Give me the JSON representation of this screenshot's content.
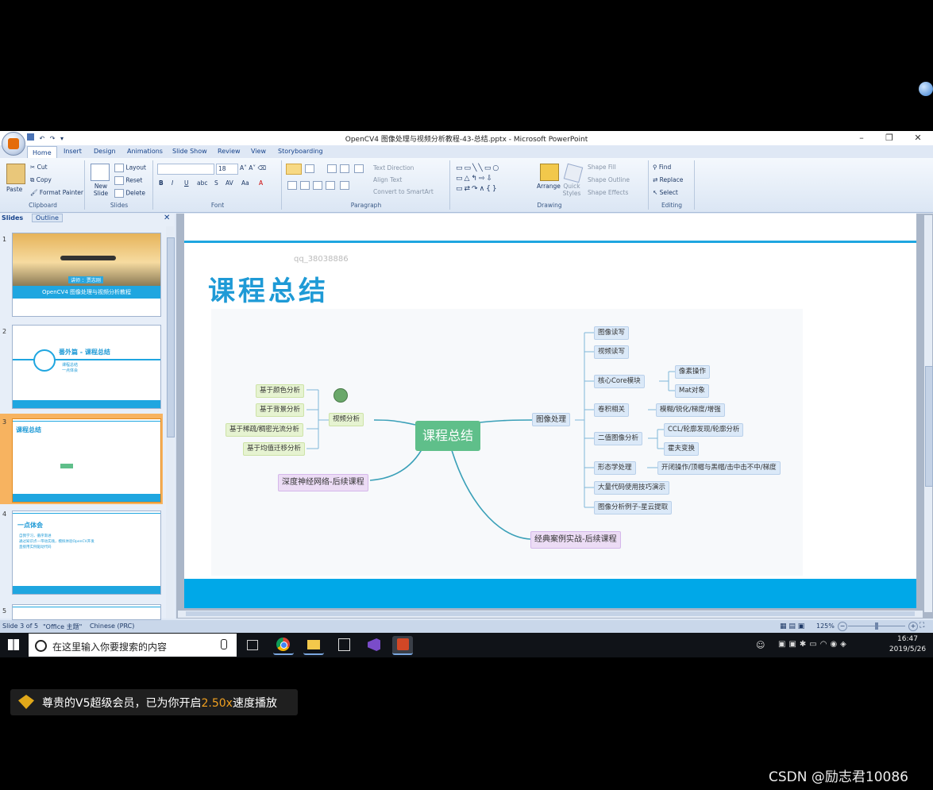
{
  "window": {
    "title": "OpenCV4 图像处理与视频分析教程-43-总结.pptx - Microsoft PowerPoint",
    "controls": {
      "minimize": "–",
      "restore": "❐",
      "close": "✕"
    }
  },
  "ribbon": {
    "tabs": [
      "Home",
      "Insert",
      "Design",
      "Animations",
      "Slide Show",
      "Review",
      "View",
      "Storyboarding"
    ],
    "active_tab": "Home",
    "clipboard": {
      "paste": "Paste",
      "cut": "Cut",
      "copy": "Copy",
      "format_painter": "Format Painter",
      "label": "Clipboard"
    },
    "slides": {
      "new_slide": "New Slide",
      "layout": "Layout",
      "reset": "Reset",
      "delete": "Delete",
      "label": "Slides"
    },
    "font": {
      "size": "18",
      "label": "Font"
    },
    "paragraph": {
      "text_direction": "Text Direction",
      "align_text": "Align Text",
      "convert_smartart": "Convert to SmartArt",
      "label": "Paragraph"
    },
    "drawing": {
      "arrange": "Arrange",
      "quick_styles": "Quick Styles",
      "shape_fill": "Shape Fill",
      "shape_outline": "Shape Outline",
      "shape_effects": "Shape Effects",
      "label": "Drawing"
    },
    "editing": {
      "find": "Find",
      "replace": "Replace",
      "select": "Select",
      "label": "Editing"
    }
  },
  "slides_pane": {
    "tabs": [
      "Slides",
      "Outline"
    ],
    "close": "✕",
    "thumbnails": [
      {
        "number": "1",
        "caption": "OpenCV4 图像处理与视频分析教程",
        "badge": "讲师 ：贾志刚"
      },
      {
        "number": "2",
        "title": "番外篇 - 课程总结",
        "bullets": [
          "课程总结",
          "一点体会"
        ]
      },
      {
        "number": "3",
        "title": "课程总结"
      },
      {
        "number": "4",
        "title": "一点体会",
        "bullets": [
          "自我学习，循序渐进",
          "通过知识点—带动实践，模拟体验OpenCV开发",
          "直接用实例驱动代码"
        ]
      },
      {
        "number": "5"
      }
    ]
  },
  "slide": {
    "watermark": "qq_38038886",
    "title": "课程总结",
    "mindmap": {
      "center": "课程总结",
      "left_branch": "视频分析",
      "left_items": [
        "基于颜色分析",
        "基于背景分析",
        "基于稀疏/稠密光流分析",
        "基于均值迁移分析"
      ],
      "deep_learning": "深度神经网络-后续课程",
      "right_branch": "图像处理",
      "right_items": [
        "图像读写",
        "视频读写",
        "核心Core模块",
        "卷积相关",
        "二值图像分析",
        "形态学处理",
        "大量代码使用技巧演示",
        "图像分析例子-星云提取"
      ],
      "core_sub": [
        "像素操作",
        "Mat对象"
      ],
      "conv_sub": [
        "模糊/锐化/梯度/增强"
      ],
      "binary_sub": [
        "CCL/轮廓发现/轮廓分析",
        "霍夫变换"
      ],
      "morph_sub": [
        "开闭操作/顶帽与黑帽/击中击不中/梯度"
      ],
      "cases": "经典案例实战-后续课程"
    }
  },
  "statusbar": {
    "slide_info": "Slide 3 of 5",
    "theme": "\"Office 主题\"",
    "language": "Chinese (PRC)",
    "zoom": "125%"
  },
  "taskbar": {
    "search_placeholder": "在这里输入你要搜索的内容",
    "time": "16:47",
    "date": "2019/5/26"
  },
  "toast": {
    "prefix": "尊贵的V5超级会员，已为你开启",
    "speed": "2.50x",
    "suffix": "速度播放"
  },
  "credit": "CSDN @励志君10086",
  "colors": {
    "accent": "#00a8e8",
    "title_blue": "#1e9ad6",
    "center_node": "#5fbf8a",
    "speed_highlight": "#f0a020"
  }
}
